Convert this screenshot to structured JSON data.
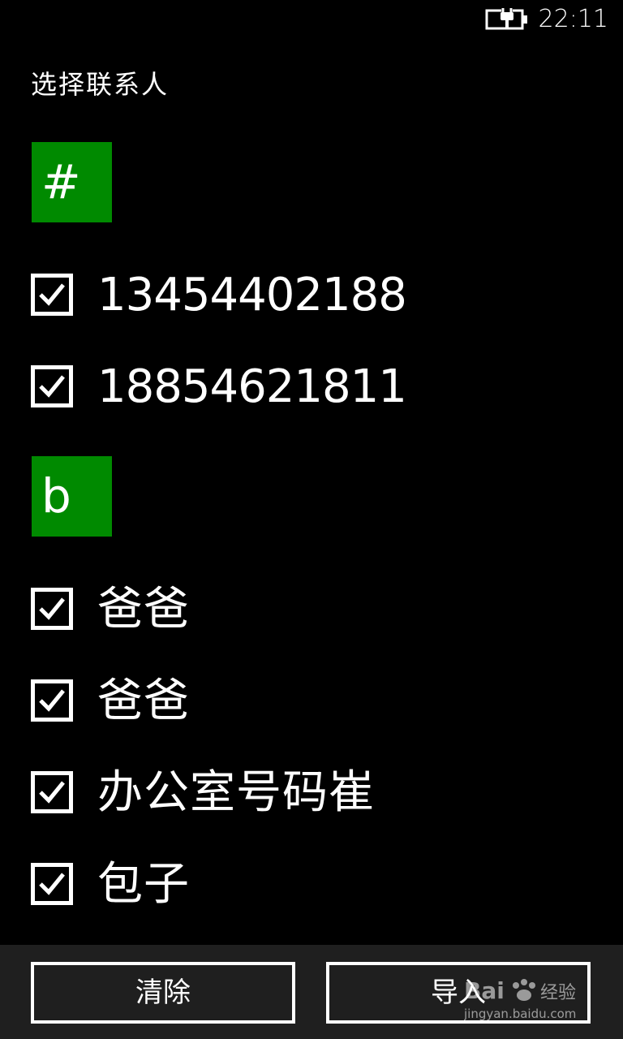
{
  "status_bar": {
    "time": "22:11",
    "battery_icon": "battery-charging-icon"
  },
  "page": {
    "title": "选择联系人"
  },
  "groups": [
    {
      "letter": "#",
      "contacts": [
        {
          "name": "13454402188",
          "checked": true
        },
        {
          "name": "18854621811",
          "checked": true
        }
      ]
    },
    {
      "letter": "b",
      "contacts": [
        {
          "name": "爸爸",
          "checked": true
        },
        {
          "name": "爸爸",
          "checked": true
        },
        {
          "name": "办公室号码崔",
          "checked": true
        },
        {
          "name": "包子",
          "checked": true
        }
      ]
    }
  ],
  "app_bar": {
    "clear_label": "清除",
    "import_label": "导入"
  },
  "colors": {
    "accent": "#008a00",
    "background": "#000000",
    "app_bar": "#1f1f1f"
  }
}
